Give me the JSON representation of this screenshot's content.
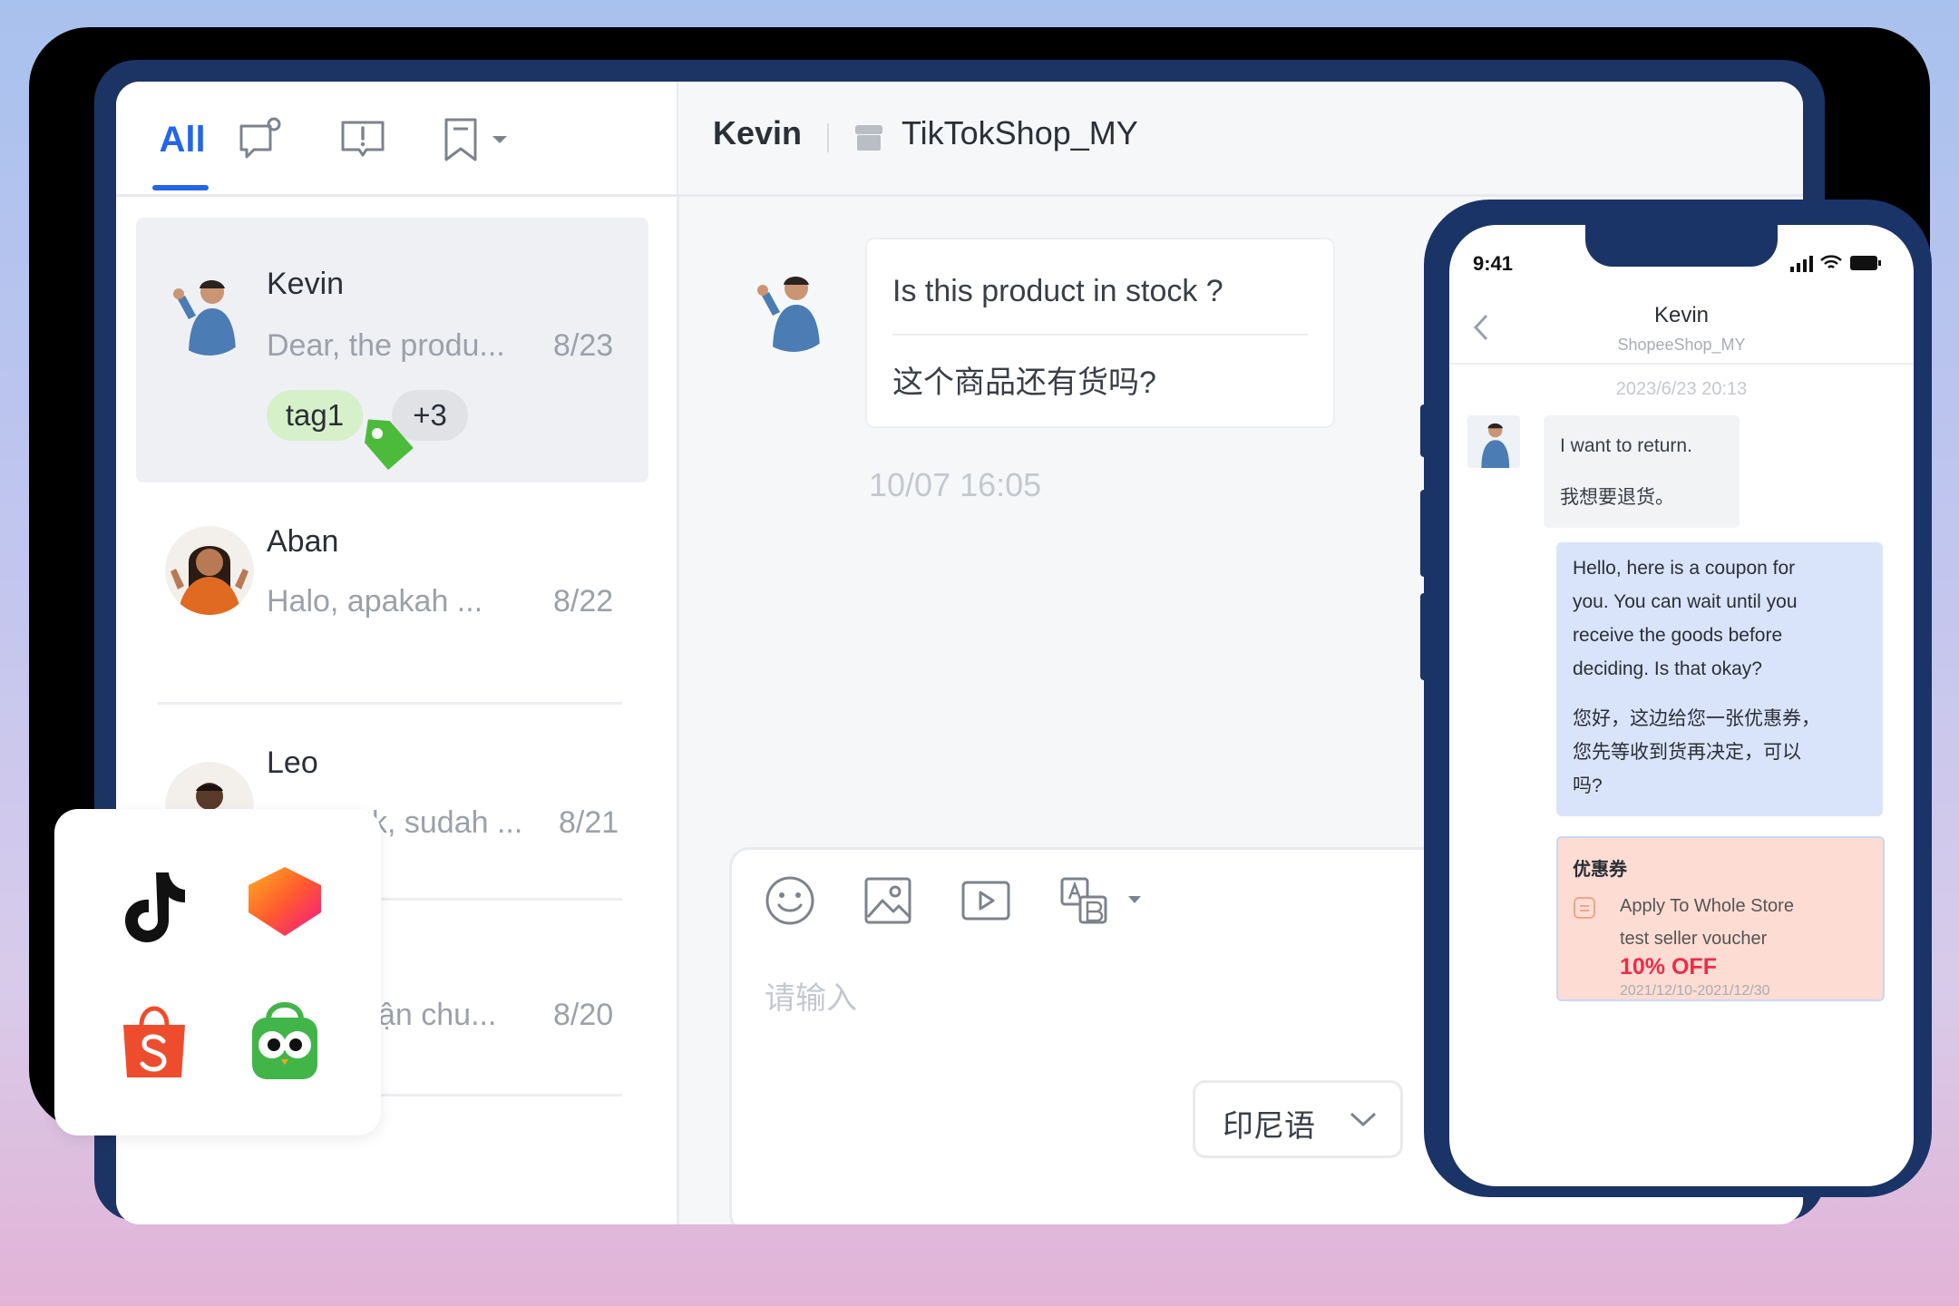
{
  "tabs": {
    "all_label": "All"
  },
  "conversations": [
    {
      "name": "Kevin",
      "preview": "Dear, the produ...",
      "date": "8/23",
      "tags": [
        "tag1",
        "+3"
      ]
    },
    {
      "name": "Aban",
      "preview": "Halo, apakah ...",
      "date": "8/22"
    },
    {
      "name": "Leo",
      "preview": "k, sudah ...",
      "date": "8/21"
    },
    {
      "name": "",
      "preview": "vận chu...",
      "date": "8/20"
    }
  ],
  "chat": {
    "header_name": "Kevin",
    "header_shop": "TikTokShop_MY",
    "message_en": "Is this product in stock ?",
    "message_zh": "这个商品还有货吗?",
    "message_time": "10/07 16:05",
    "input_placeholder": "请输入",
    "language": "印尼语"
  },
  "phone": {
    "status_time": "9:41",
    "contact_name": "Kevin",
    "contact_shop": "ShopeeShop_MY",
    "date": "2023/6/23 20:13",
    "incoming_en": "I want to return.",
    "incoming_zh": "我想要退货。",
    "reply_en": [
      "Hello, here is a coupon for",
      "you. You can wait until you",
      "receive the goods before",
      "deciding. Is that okay?"
    ],
    "reply_zh": [
      "您好，这边给您一张优惠券，",
      "您先等收到货再决定，可以",
      "吗?"
    ],
    "coupon_title": "优惠券",
    "coupon_scope": "Apply To Whole Store",
    "coupon_name": "test seller voucher",
    "coupon_discount": "10% OFF",
    "coupon_validity": "2021/12/10-2021/12/30"
  },
  "marketplaces": [
    "tiktok-logo",
    "lazada-logo",
    "shopee-logo",
    "tokopedia-logo"
  ],
  "colors": {
    "accent": "#2466e8",
    "frame": "#1c3464",
    "tag_green": "#4cbb3c",
    "coupon_red": "#ee2b48"
  }
}
